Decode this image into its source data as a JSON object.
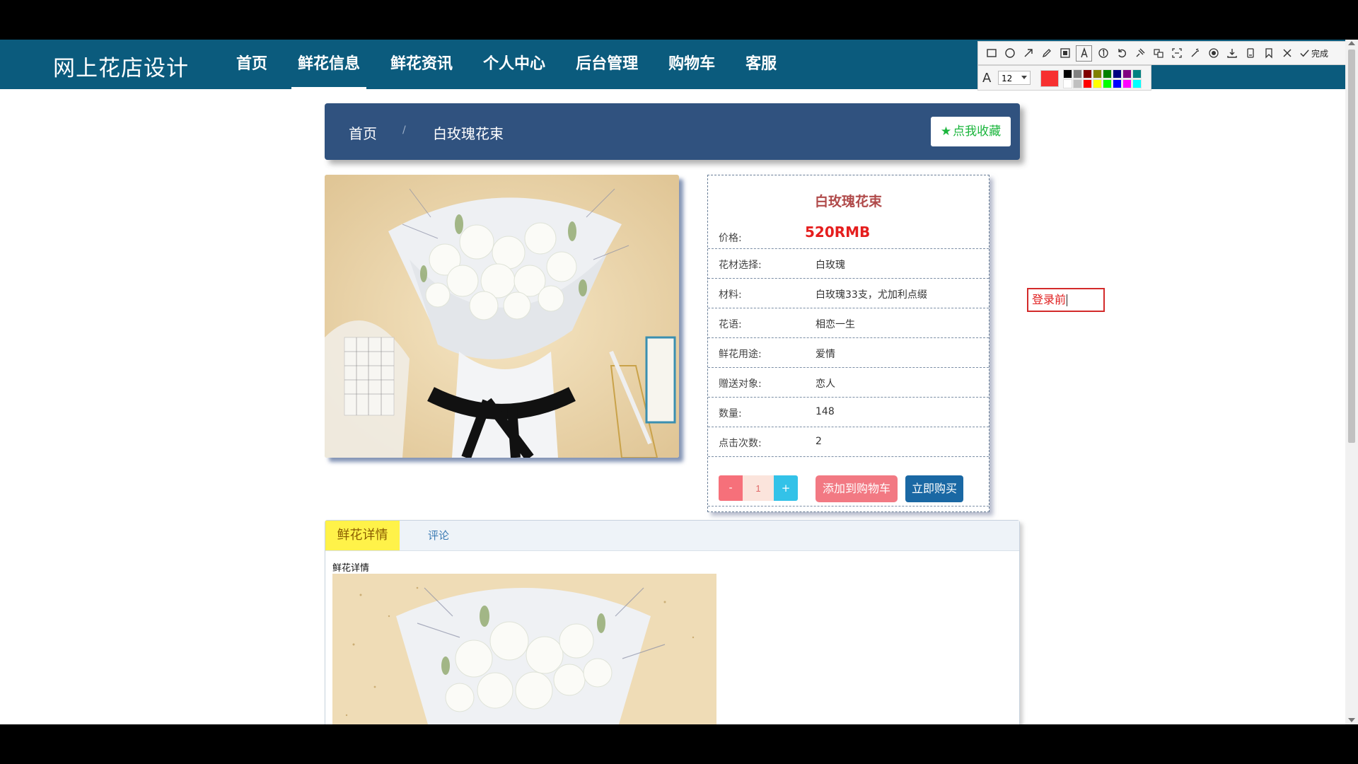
{
  "nav": {
    "brand": "网上花店设计",
    "items": [
      {
        "label": "首页",
        "active": false
      },
      {
        "label": "鲜花信息",
        "active": true
      },
      {
        "label": "鲜花资讯",
        "active": false
      },
      {
        "label": "个人中心",
        "active": false
      },
      {
        "label": "后台管理",
        "active": false
      },
      {
        "label": "购物车",
        "active": false
      },
      {
        "label": "客服",
        "active": false
      }
    ]
  },
  "breadcrumb": {
    "home": "首页",
    "separator": "/",
    "current": "白玫瑰花束",
    "favorite_label": "点我收藏"
  },
  "product": {
    "title": "白玫瑰花束",
    "price_label": "价格:",
    "price": "520RMB",
    "rows": [
      {
        "label": "花材选择:",
        "value": "白玫瑰"
      },
      {
        "label": "材料:",
        "value": "白玫瑰33支，尤加利点缀"
      },
      {
        "label": "花语:",
        "value": "相恋一生"
      },
      {
        "label": "鲜花用途:",
        "value": "爱情"
      },
      {
        "label": "赠送对象:",
        "value": "恋人"
      },
      {
        "label": "数量:",
        "value": "148"
      },
      {
        "label": "点击次数:",
        "value": "2"
      }
    ],
    "qty_minus": "-",
    "qty_value": "1",
    "qty_plus": "+",
    "add_to_cart": "添加到购物车",
    "buy_now": "立即购买"
  },
  "tabs": {
    "detail_label": "鲜花详情",
    "comments_label": "评论",
    "detail_heading": "鲜花详情"
  },
  "annotation": {
    "text": "登录前"
  },
  "snip_tool": {
    "done_label": "完成",
    "font_size": "12",
    "current_color": "#f73030",
    "palette": [
      "#000000",
      "#808080",
      "#800000",
      "#808000",
      "#008000",
      "#000080",
      "#800080",
      "#008080",
      "#ffffff",
      "#c0c0c0",
      "#ff0000",
      "#ffff00",
      "#00ff00",
      "#0000ff",
      "#ff00ff",
      "#00ffff"
    ],
    "icons": [
      "rectangle-icon",
      "ellipse-icon",
      "arrow-icon",
      "pen-icon",
      "mosaic-icon",
      "text-icon",
      "number-icon",
      "undo-icon",
      "pin-icon",
      "translate-icon",
      "ocr-icon",
      "magic-icon",
      "record-icon",
      "download-icon",
      "save-icon",
      "bookmark-icon",
      "close-icon"
    ]
  },
  "colors": {
    "nav_bg": "#0b5b7d",
    "breadcrumb_bg": "#30527f",
    "price": "#e51e1e",
    "title": "#b04a4a",
    "add_cart": "#f27983",
    "buy_now": "#1a68a4",
    "tab_active": "#fff249"
  }
}
